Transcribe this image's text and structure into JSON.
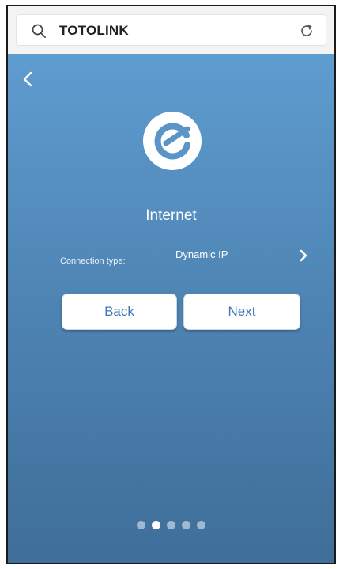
{
  "browser": {
    "url_text": "TOTOLINK"
  },
  "page": {
    "title": "Internet",
    "connection_label": "Connection type:",
    "connection_value": "Dynamic IP",
    "back_label": "Back",
    "next_label": "Next"
  },
  "pagination": {
    "total": 5,
    "current": 2
  },
  "colors": {
    "background_top": "#5f9ccf",
    "background_bottom": "#3f6e99",
    "button_text": "#3f78b2"
  },
  "icons": [
    "search-icon",
    "reload-icon",
    "back-chevron-icon",
    "internet-logo-icon",
    "chevron-right-icon"
  ]
}
